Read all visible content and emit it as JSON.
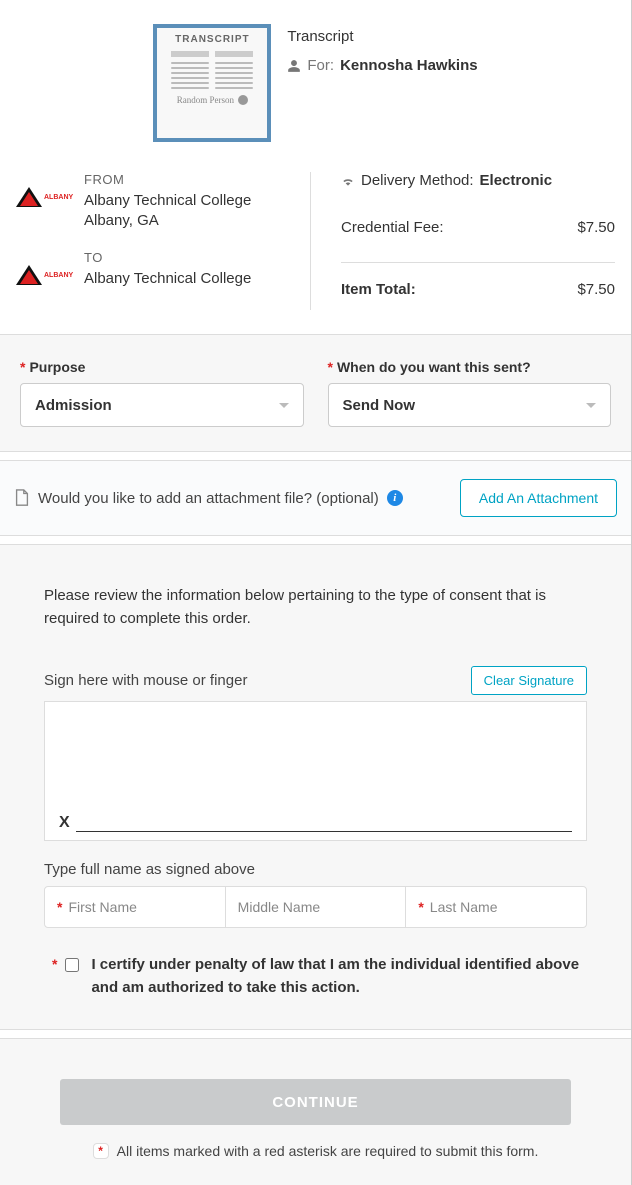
{
  "header": {
    "thumb_title": "TRANSCRIPT",
    "doc_type": "Transcript",
    "for_label": "For:",
    "for_name": "Kennosha Hawkins"
  },
  "from": {
    "label": "FROM",
    "name": "Albany Technical College",
    "location": "Albany, GA"
  },
  "to": {
    "label": "TO",
    "name": "Albany Technical College"
  },
  "delivery": {
    "method_label": "Delivery Method:",
    "method_value": "Electronic",
    "fee_label": "Credential Fee:",
    "fee_value": "$7.50",
    "total_label": "Item Total:",
    "total_value": "$7.50"
  },
  "fields": {
    "purpose_label": "Purpose",
    "purpose_value": "Admission",
    "when_label": "When do you want this sent?",
    "when_value": "Send Now"
  },
  "attach": {
    "question": "Would you like to add an attachment file? (optional)",
    "button": "Add An Attachment"
  },
  "consent": {
    "intro": "Please review the information below pertaining to the type of consent that is required to complete this order.",
    "sign_label": "Sign here with mouse or finger",
    "clear_button": "Clear Signature",
    "sign_x": "X",
    "name_label": "Type full name as signed above",
    "first_ph": "First Name",
    "middle_ph": "Middle Name",
    "last_ph": "Last Name",
    "certify_text": "I certify under penalty of law that I am the individual identified above and am authorized to take this action."
  },
  "footer": {
    "continue": "CONTINUE",
    "note": "All items marked with a red asterisk are required to submit this form."
  }
}
